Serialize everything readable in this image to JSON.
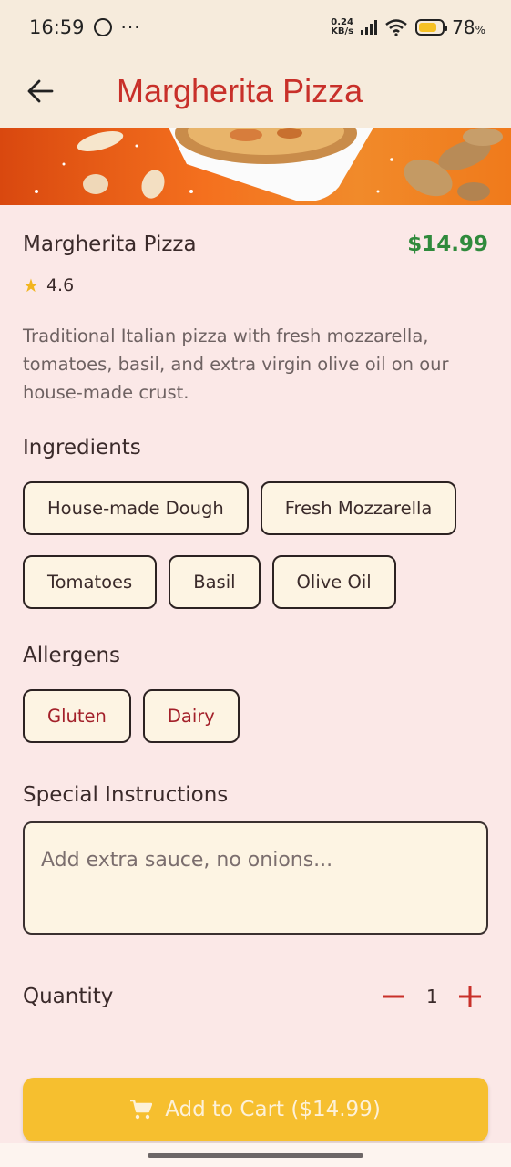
{
  "status_bar": {
    "time": "16:59",
    "more": "···",
    "net_speed_value": "0.24",
    "net_speed_unit": "KB/s",
    "battery_percent": "78",
    "battery_unit": "%",
    "battery_level": 0.78
  },
  "app_bar": {
    "title": "Margherita Pizza"
  },
  "item": {
    "name": "Margherita Pizza",
    "price": "$14.99",
    "rating": "4.6",
    "description": "Traditional Italian pizza with fresh mozzarella, tomatoes, basil, and extra virgin olive oil on our house-made crust."
  },
  "ingredients": {
    "title": "Ingredients",
    "items": [
      "House-made Dough",
      "Fresh Mozzarella",
      "Tomatoes",
      "Basil",
      "Olive Oil"
    ]
  },
  "allergens": {
    "title": "Allergens",
    "items": [
      "Gluten",
      "Dairy"
    ]
  },
  "special_instructions": {
    "title": "Special Instructions",
    "placeholder": "Add extra sauce, no onions..."
  },
  "quantity": {
    "label": "Quantity",
    "value": "1"
  },
  "cart_button": {
    "label": "Add to Cart ($14.99)"
  },
  "colors": {
    "brand": "#c8302a",
    "price": "#2f8a3c",
    "accent": "#f6bf2f",
    "background": "#fbe8e7",
    "header": "#f6ebdc"
  }
}
